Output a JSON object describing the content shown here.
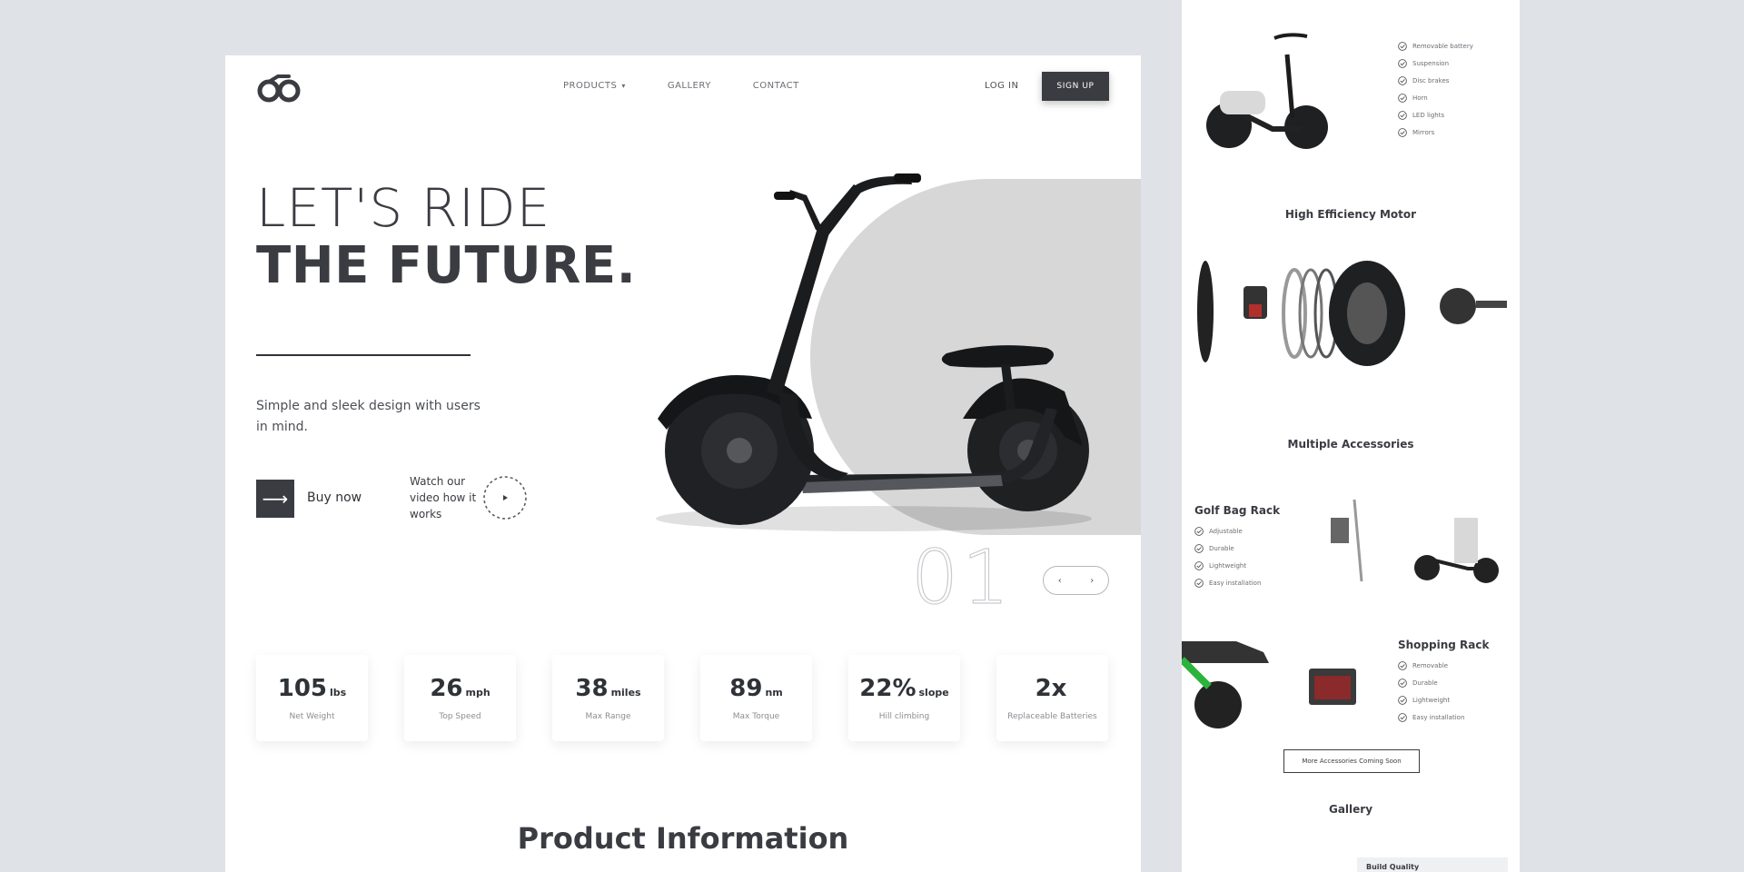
{
  "nav": {
    "items": [
      {
        "label": "PRODUCTS",
        "has_dropdown": true
      },
      {
        "label": "GALLERY",
        "has_dropdown": false
      },
      {
        "label": "CONTACT",
        "has_dropdown": false
      }
    ],
    "login": "LOG IN",
    "signup": "SIGN UP",
    "logo_icon": "co-logo-icon"
  },
  "hero": {
    "line1": "LET'S RIDE",
    "line2": "THE FUTURE.",
    "subtitle": "Simple and sleek design with users in mind.",
    "buy_label": "Buy now",
    "watch_text": "Watch our video how it works",
    "slide_number": "01"
  },
  "stats": [
    {
      "value": "105",
      "unit": "lbs",
      "label": "Net Weight"
    },
    {
      "value": "26",
      "unit": "mph",
      "label": "Top Speed"
    },
    {
      "value": "38",
      "unit": "miles",
      "label": "Max Range"
    },
    {
      "value": "89",
      "unit": "nm",
      "label": "Max Torque"
    },
    {
      "value": "22%",
      "unit": "slope",
      "label": "Hill climbing"
    },
    {
      "value": "2x",
      "unit": "",
      "label": "Replaceable Batteries"
    }
  ],
  "section_title": "Product Information",
  "side": {
    "features": [
      "Removable battery",
      "Suspension",
      "Disc brakes",
      "Horn",
      "LED lights",
      "Mirrors"
    ],
    "motor_title": "High Efficiency Motor",
    "accessories_title": "Multiple Accessories",
    "golf_title": "Golf Bag Rack",
    "golf_features": [
      "Adjustable",
      "Durable",
      "Lightweight",
      "Easy installation"
    ],
    "shopping_title": "Shopping Rack",
    "shopping_features": [
      "Removable",
      "Durable",
      "Lightweight",
      "Easy installation"
    ],
    "accessory_button": "More Accessories Coming Soon",
    "gallery_title": "Gallery",
    "build_quality": "Build Quality"
  },
  "colors": {
    "primary": "#3a3c42",
    "background": "#dfe2e7",
    "disc": "#d7d7d7",
    "card": "#ffffff"
  }
}
